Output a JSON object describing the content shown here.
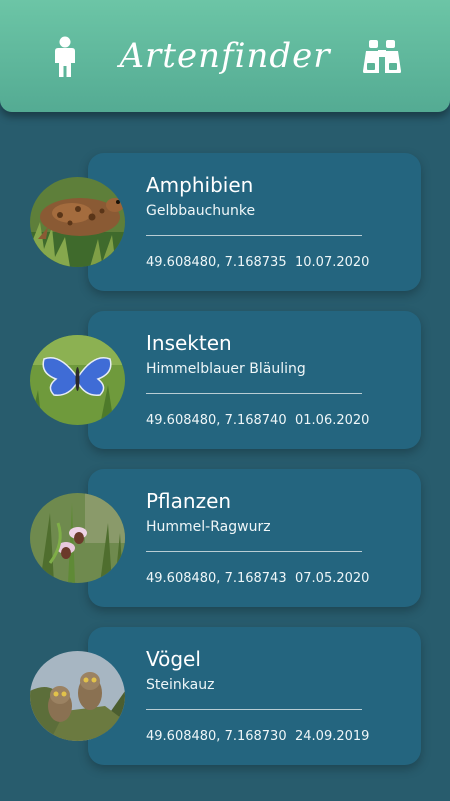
{
  "app": {
    "title": "Artenfinder",
    "left_icon": "person-icon",
    "right_icon": "binoculars-icon"
  },
  "entries": [
    {
      "category": "Amphibien",
      "species": "Gelbbauchunke",
      "coords": "49.608480, 7.168735",
      "date": "10.07.2020",
      "image": "toad-photo"
    },
    {
      "category": "Insekten",
      "species": "Himmelblauer Bläuling",
      "coords": "49.608480, 7.168740",
      "date": "01.06.2020",
      "image": "blue-butterfly-photo"
    },
    {
      "category": "Pflanzen",
      "species": "Hummel-Ragwurz",
      "coords": "49.608480, 7.168743",
      "date": "07.05.2020",
      "image": "orchid-photo"
    },
    {
      "category": "Vögel",
      "species": "Steinkauz",
      "coords": "49.608480, 7.168730",
      "date": "24.09.2019",
      "image": "owls-photo"
    }
  ],
  "colors": {
    "background": "#285c6d",
    "card": "#24657f",
    "header_top": "#6cc5a6",
    "header_bottom": "#54ab93"
  }
}
